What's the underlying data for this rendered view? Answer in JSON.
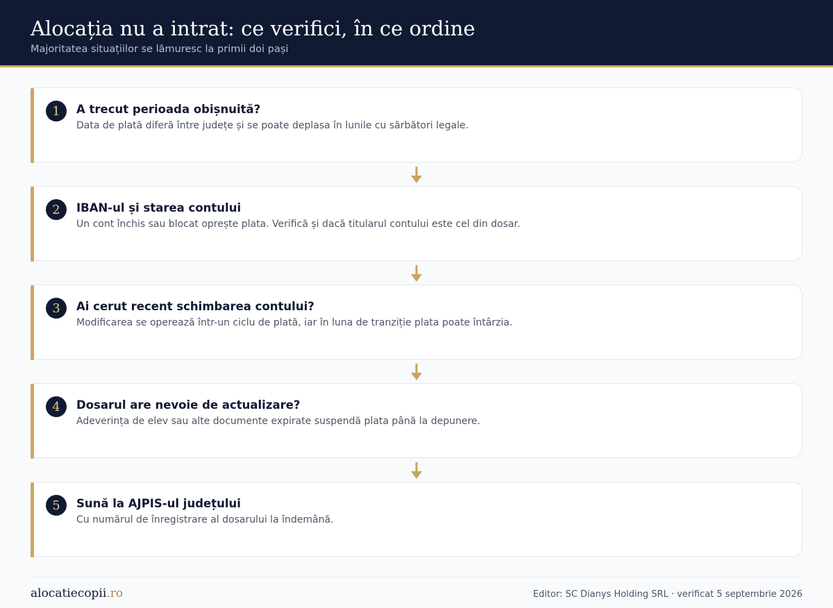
{
  "header": {
    "title": "Alocația nu a intrat: ce verifici, în ce ordine",
    "subtitle": "Majoritatea situațiilor se lămuresc la primii doi pași"
  },
  "steps": [
    {
      "number": "1",
      "title": "A trecut perioada obișnuită?",
      "description": "Data de plată diferă între județe și se poate deplasa în lunile cu sărbători legale."
    },
    {
      "number": "2",
      "title": "IBAN-ul și starea contului",
      "description": "Un cont închis sau blocat oprește plata. Verifică și dacă titularul contului este cel din dosar."
    },
    {
      "number": "3",
      "title": "Ai cerut recent schimbarea contului?",
      "description": "Modificarea se operează într-un ciclu de plată, iar în luna de tranziție plata poate întârzia."
    },
    {
      "number": "4",
      "title": "Dosarul are nevoie de actualizare?",
      "description": "Adeverința de elev sau alte documente expirate suspendă plata până la depunere."
    },
    {
      "number": "5",
      "title": "Sună la AJPIS-ul județului",
      "description": "Cu numărul de înregistrare al dosarului la îndemână."
    }
  ],
  "footer": {
    "brand_name": "alocatiecopii",
    "brand_tld": ".ro",
    "note": "Editor: SC Dianys Holding SRL · verificat 5 septembrie 2026"
  },
  "colors": {
    "navy": "#111a33",
    "gold": "#c9a45c",
    "background": "#f8fafc"
  }
}
